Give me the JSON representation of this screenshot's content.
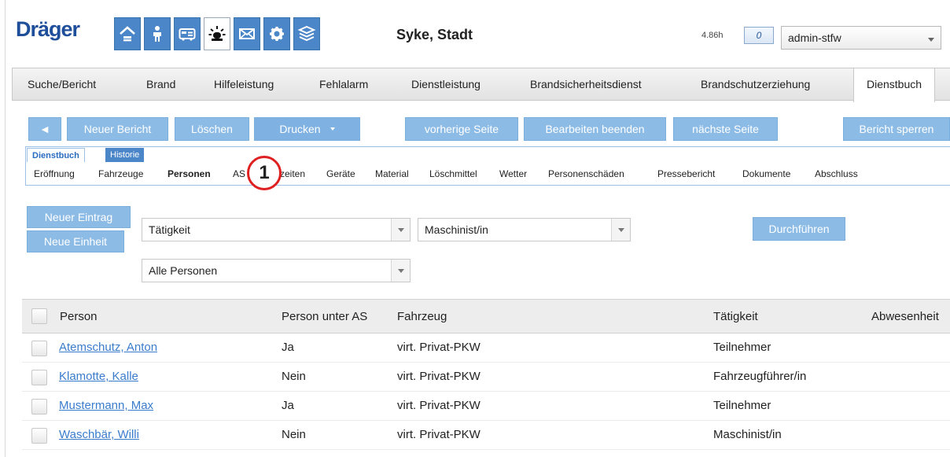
{
  "header": {
    "logo": "Dräger",
    "icons": [
      "home-icon",
      "person-icon",
      "vehicle-icon",
      "alarm-light-icon",
      "mail-icon",
      "gear-icon",
      "layers-icon"
    ],
    "city": "Syke, Stadt",
    "timer": "4.86h",
    "counter": "0",
    "user": "admin-stfw"
  },
  "tabs": [
    "Suche/Bericht",
    "Brand",
    "Hilfeleistung",
    "Fehlalarm",
    "Dienstleistung",
    "Brandsicherheitsdienst",
    "Brandschutzerziehung",
    "Dienstbuch"
  ],
  "active_tab": "Dienstbuch",
  "toolbar": {
    "back": "◄",
    "new_report": "Neuer Bericht",
    "delete": "Löschen",
    "print": "Drucken",
    "prev_page": "vorherige Seite",
    "end_edit": "Bearbeiten beenden",
    "next_page": "nächste Seite",
    "lock_report": "Bericht sperren"
  },
  "subtabs": [
    "Dienstbuch",
    "Historie"
  ],
  "subnav": [
    "Eröffnung",
    "Fahrzeuge",
    "Personen",
    "AS",
    "zeiten",
    "Geräte",
    "Material",
    "Löschmittel",
    "Wetter",
    "Personenschäden",
    "Pressebericht",
    "Dokumente",
    "Abschluss"
  ],
  "subnav_active": "Personen",
  "marker": "1",
  "actions": {
    "new_entry": "Neuer Eintrag",
    "new_unit": "Neue Einheit",
    "execute": "Durchführen"
  },
  "filters": {
    "field": "Tätigkeit",
    "value": "Maschinist/in",
    "persons": "Alle Personen"
  },
  "table": {
    "columns": [
      "Person",
      "Person unter AS",
      "Fahrzeug",
      "Tätigkeit",
      "Abwesenheit"
    ],
    "rows": [
      {
        "person": "Atemschutz, Anton",
        "as": "Ja",
        "vehicle": "virt. Privat-PKW",
        "activity": "Teilnehmer"
      },
      {
        "person": "Klamotte, Kalle",
        "as": "Nein",
        "vehicle": "virt. Privat-PKW",
        "activity": "Fahrzeugführer/in"
      },
      {
        "person": "Mustermann, Max",
        "as": "Ja",
        "vehicle": "virt. Privat-PKW",
        "activity": "Teilnehmer"
      },
      {
        "person": "Waschbär, Willi",
        "as": "Nein",
        "vehicle": "virt. Privat-PKW",
        "activity": "Maschinist/in"
      }
    ]
  },
  "colors": {
    "brand": "#1f4f9a",
    "button": "#8cbbe6",
    "icon_blue": "#4a86c8",
    "link": "#3a7ccc",
    "marker": "#e02020"
  }
}
